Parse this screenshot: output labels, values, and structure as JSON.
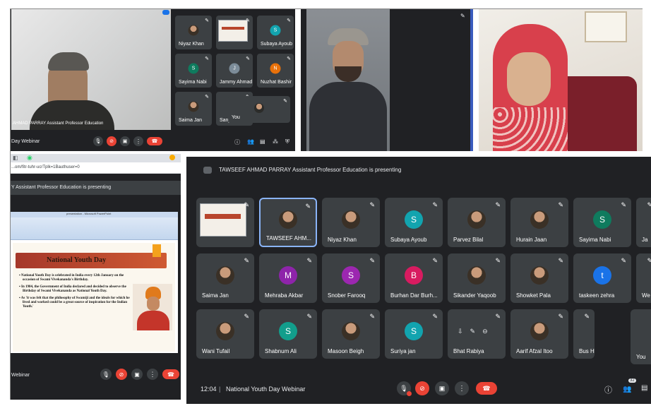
{
  "panel_a": {
    "presenter_caption": "AHMAD PARRAY Assistant Professor Education",
    "webinar_title": "Day Webinar",
    "tiles": [
      {
        "name": "Niyaz Khan",
        "kind": "photo"
      },
      {
        "name": "",
        "kind": "screen"
      },
      {
        "name": "Subaya Ayoub",
        "kind": "avatar",
        "letter": "S",
        "color": "#12a4af"
      },
      {
        "name": "Sayima Nabi",
        "kind": "avatar",
        "letter": "S",
        "color": "#0f7b5e"
      },
      {
        "name": "Jammy Ahmad",
        "kind": "avatar",
        "letter": "J",
        "color": "#7c8c99"
      },
      {
        "name": "Nuzhat Bashir",
        "kind": "avatar",
        "letter": "N",
        "color": "#e8710a"
      },
      {
        "name": "Saima Jan",
        "kind": "photo"
      },
      {
        "name": "Sanjo",
        "kind": "photo"
      },
      {
        "name": "You",
        "kind": "self"
      }
    ]
  },
  "panel_d": {
    "url_text": "...om/fitr-tuhr-ucrTplk=1Bauthuser=0",
    "presenting_banner": "Y Assistant Professor Education is presenting",
    "slide_app_title": "presentation - Microsoft PowerPoint",
    "slide": {
      "title": "National Youth Day",
      "bullets": [
        "National Youth Day is celebrated in India every 12th January on the occasion of Swami Vivekananda's Birthday.",
        "In 1984, the Government of India declared and decided to observe the Birthday of Swami Vivekananda as National Youth Day.",
        "As 'it was felt that the philosophy of Swamiji and the ideals for which he lived and worked could be a great source of inspiration for the Indian Youth.'"
      ]
    },
    "webinar_title": "Webinar"
  },
  "panel_e": {
    "presenting_banner": "TAWSEEF AHMAD PARRAY Assistant Professor Education is presenting",
    "time": "12:04",
    "separator": "|",
    "meeting_title": "National Youth Day Webinar",
    "participant_count": "32",
    "tiles": [
      {
        "name": "",
        "kind": "screen"
      },
      {
        "name": "TAWSEEF AHM...",
        "kind": "photo",
        "active": true
      },
      {
        "name": "Niyaz Khan",
        "kind": "photo"
      },
      {
        "name": "Subaya Ayoub",
        "kind": "avatar",
        "letter": "S",
        "color": "#12a4af"
      },
      {
        "name": "Parvez Bilal",
        "kind": "photo"
      },
      {
        "name": "Hurain Jaan",
        "kind": "photo"
      },
      {
        "name": "Sayima Nabi",
        "kind": "avatar",
        "letter": "S",
        "color": "#0f7b5e"
      },
      {
        "name": "Ja",
        "kind": "cut"
      },
      {
        "name": "Saima Jan",
        "kind": "photo"
      },
      {
        "name": "Mehraba Akbar",
        "kind": "avatar",
        "letter": "M",
        "color": "#8e24aa"
      },
      {
        "name": "Snober Farooq",
        "kind": "avatar",
        "letter": "S",
        "color": "#9c27b0"
      },
      {
        "name": "Burhan Dar Burh...",
        "kind": "avatar",
        "letter": "B",
        "color": "#d81b60"
      },
      {
        "name": "Sikander Yaqoob",
        "kind": "photo"
      },
      {
        "name": "Showket Pala",
        "kind": "photo"
      },
      {
        "name": "taskeen zehra",
        "kind": "avatar",
        "letter": "t",
        "color": "#1a73e8"
      },
      {
        "name": "We",
        "kind": "cut"
      },
      {
        "name": "Wani Tufail",
        "kind": "photo"
      },
      {
        "name": "Shabnum Ali",
        "kind": "avatar",
        "letter": "S",
        "color": "#129e8c"
      },
      {
        "name": "Masoon Beigh",
        "kind": "photo"
      },
      {
        "name": "Suriya jan",
        "kind": "avatar",
        "letter": "S",
        "color": "#12a4af"
      },
      {
        "name": "Bhat Rabiya",
        "kind": "controls"
      },
      {
        "name": "Aarif Afzal Itoo",
        "kind": "photo"
      },
      {
        "name": "Bus H",
        "kind": "cut"
      },
      {
        "name": "You",
        "kind": "self"
      }
    ]
  },
  "colors": {
    "meet_bg": "#202124",
    "tile_bg": "#3c4043",
    "end_call": "#ea4335",
    "active_border": "#8ab4f8"
  }
}
